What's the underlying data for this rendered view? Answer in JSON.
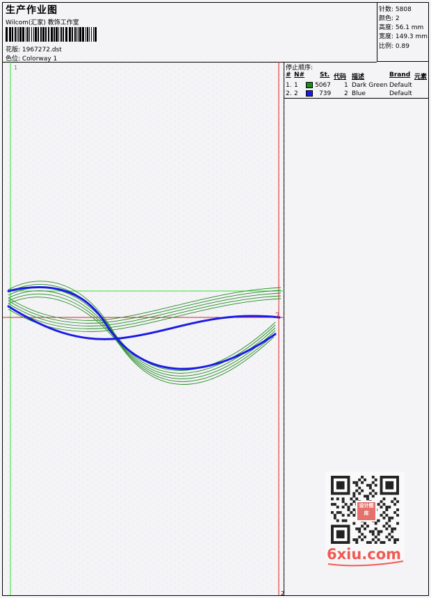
{
  "header": {
    "title": "生产作业图",
    "studio": "Wilcom(汇家) 教饰工作室",
    "design_label": "花版: 1967272.dst",
    "colorway_label": "色位: Colorway 1"
  },
  "stats": {
    "stitches": "针数: 5808",
    "colors": "颜色: 2",
    "height": "高度: 56.1 mm",
    "width": "宽度: 149.3 mm",
    "scale": "比例: 0.89"
  },
  "stop_sequence": {
    "title": "停止顺序:",
    "columns": [
      "#",
      "N#",
      "St.",
      "代码",
      "描述",
      "Brand",
      "元素"
    ],
    "rows": [
      {
        "index": "1.",
        "needle": "1",
        "color": "#1e8a1e",
        "stitches": "5067",
        "code": "1",
        "description": "Dark Green",
        "brand": "Default"
      },
      {
        "index": "2.",
        "needle": "2",
        "color": "#1a1ae6",
        "stitches": "739",
        "code": "2",
        "description": "Blue",
        "brand": "Default"
      }
    ]
  },
  "markers": {
    "stop1": "1",
    "stop2": "2",
    "bottom": "2"
  },
  "watermark": {
    "text": "6xiu.com",
    "badge": "设计图库"
  },
  "colors": {
    "green": "#1e8a1e",
    "blue": "#1a1ae6",
    "guide_green": "#33dd33",
    "guide_red": "#dd2222"
  }
}
